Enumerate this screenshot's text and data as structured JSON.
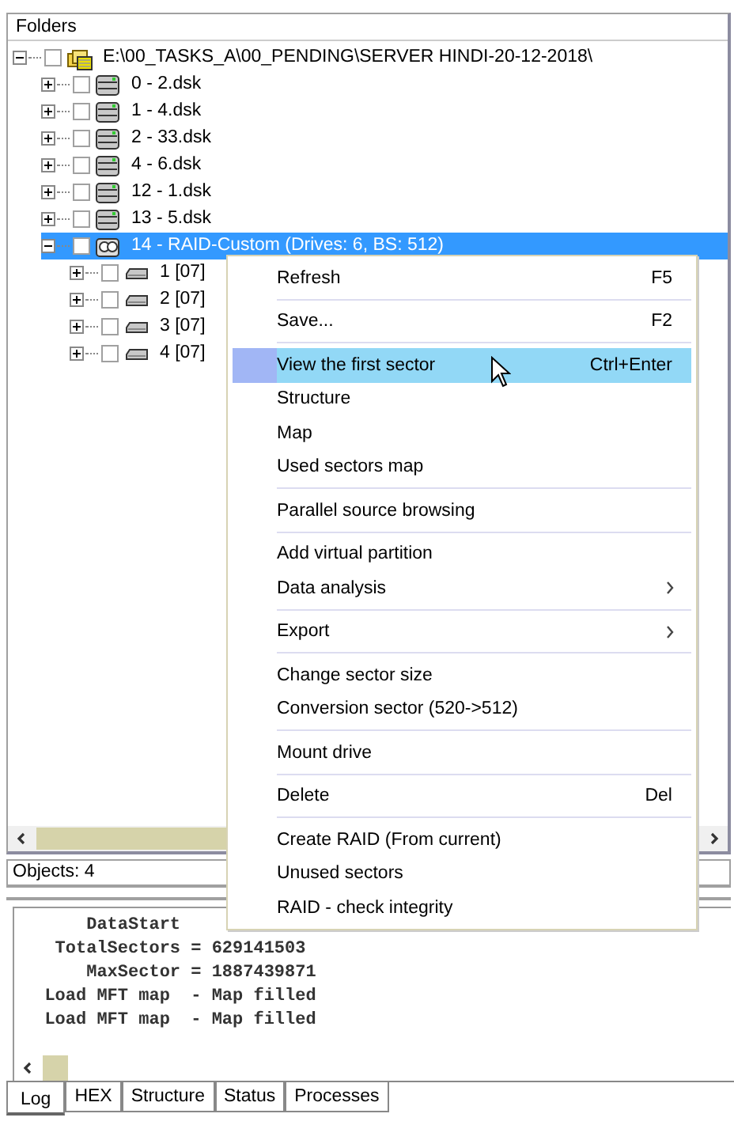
{
  "folders_panel": {
    "title": "Folders",
    "tree": [
      {
        "label": "E:\\00_TASKS_A\\00_PENDING\\SERVER HINDI-20-12-2018\\",
        "kind": "folder",
        "expanded": true,
        "checked": false,
        "selected": false,
        "children": [
          {
            "label": "0 - 2.dsk",
            "kind": "disk",
            "expanded": false,
            "checked": false,
            "selected": false
          },
          {
            "label": "1 - 4.dsk",
            "kind": "disk",
            "expanded": false,
            "checked": false,
            "selected": false
          },
          {
            "label": "2 - 33.dsk",
            "kind": "disk",
            "expanded": false,
            "checked": false,
            "selected": false
          },
          {
            "label": "4 - 6.dsk",
            "kind": "disk",
            "expanded": false,
            "checked": false,
            "selected": false
          },
          {
            "label": "12 - 1.dsk",
            "kind": "disk",
            "expanded": false,
            "checked": false,
            "selected": false
          },
          {
            "label": "13 - 5.dsk",
            "kind": "disk",
            "expanded": false,
            "checked": false,
            "selected": false
          },
          {
            "label": "14 - RAID-Custom (Drives: 6, BS: 512)",
            "kind": "raid",
            "expanded": true,
            "checked": false,
            "selected": true,
            "children": [
              {
                "label": "1 [07]",
                "kind": "drive",
                "expanded": false,
                "checked": false,
                "selected": false
              },
              {
                "label": "2 [07]",
                "kind": "drive",
                "expanded": false,
                "checked": false,
                "selected": false
              },
              {
                "label": "3 [07]",
                "kind": "drive",
                "expanded": false,
                "checked": false,
                "selected": false
              },
              {
                "label": "4 [07]",
                "kind": "drive",
                "expanded": false,
                "checked": false,
                "selected": false
              }
            ]
          }
        ]
      }
    ]
  },
  "status_bar": {
    "text": "Objects: 4"
  },
  "log": {
    "lines": [
      "      DataStart",
      "   TotalSectors = 629141503",
      "      MaxSector = 1887439871",
      "  Load MFT map  - Map filled",
      "  Load MFT map  - Map filled"
    ]
  },
  "tabs": [
    {
      "label": "Log",
      "selected": true
    },
    {
      "label": "HEX",
      "selected": false
    },
    {
      "label": "Structure",
      "selected": false
    },
    {
      "label": "Status",
      "selected": false
    },
    {
      "label": "Processes",
      "selected": false
    }
  ],
  "context_menu": {
    "items": [
      {
        "kind": "item",
        "label": "Refresh",
        "shortcut": "F5",
        "submenu": false,
        "selected": false
      },
      {
        "kind": "separator"
      },
      {
        "kind": "item",
        "label": "Save...",
        "shortcut": "F2",
        "submenu": false,
        "selected": false
      },
      {
        "kind": "separator"
      },
      {
        "kind": "item",
        "label": "View the first sector",
        "shortcut": "Ctrl+Enter",
        "submenu": false,
        "selected": true
      },
      {
        "kind": "item",
        "label": "Structure",
        "submenu": false,
        "selected": false
      },
      {
        "kind": "item",
        "label": "Map",
        "submenu": false,
        "selected": false
      },
      {
        "kind": "item",
        "label": "Used sectors map",
        "submenu": false,
        "selected": false
      },
      {
        "kind": "separator"
      },
      {
        "kind": "item",
        "label": "Parallel source browsing",
        "submenu": false,
        "selected": false
      },
      {
        "kind": "separator"
      },
      {
        "kind": "item",
        "label": "Add virtual partition",
        "submenu": false,
        "selected": false
      },
      {
        "kind": "item",
        "label": "Data analysis",
        "submenu": true,
        "selected": false
      },
      {
        "kind": "separator"
      },
      {
        "kind": "item",
        "label": "Export",
        "submenu": true,
        "selected": false
      },
      {
        "kind": "separator"
      },
      {
        "kind": "item",
        "label": "Change sector size",
        "submenu": false,
        "selected": false
      },
      {
        "kind": "item",
        "label": "Conversion sector (520->512)",
        "submenu": false,
        "selected": false
      },
      {
        "kind": "separator"
      },
      {
        "kind": "item",
        "label": "Mount drive",
        "submenu": false,
        "selected": false
      },
      {
        "kind": "separator"
      },
      {
        "kind": "item",
        "label": "Delete",
        "shortcut": "Del",
        "submenu": false,
        "selected": false
      },
      {
        "kind": "separator"
      },
      {
        "kind": "item",
        "label": "Create RAID (From current)",
        "submenu": false,
        "selected": false
      },
      {
        "kind": "item",
        "label": "Unused sectors",
        "submenu": false,
        "selected": false
      },
      {
        "kind": "item",
        "label": "RAID - check integrity",
        "submenu": false,
        "selected": false
      }
    ]
  }
}
